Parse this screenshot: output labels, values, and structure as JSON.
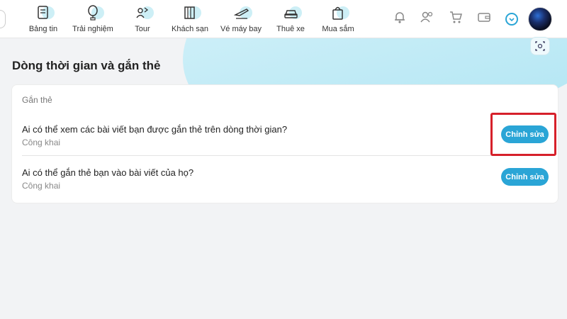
{
  "nav": {
    "items": [
      {
        "label": "Bảng tin",
        "icon": "book-icon"
      },
      {
        "label": "Trải nghiệm",
        "icon": "balloon-icon"
      },
      {
        "label": "Tour",
        "icon": "tour-icon"
      },
      {
        "label": "Khách sạn",
        "icon": "hotel-icon"
      },
      {
        "label": "Vé máy bay",
        "icon": "plane-icon"
      },
      {
        "label": "Thuê xe",
        "icon": "car-icon"
      },
      {
        "label": "Mua sắm",
        "icon": "shopping-bag-icon"
      }
    ]
  },
  "page": {
    "title": "Dòng thời gian và gắn thẻ"
  },
  "card": {
    "section_label": "Gắn thẻ",
    "rows": [
      {
        "question": "Ai có thể xem các bài viết bạn được gắn thẻ trên dòng thời gian?",
        "value": "Công khai",
        "button": "Chỉnh sửa"
      },
      {
        "question": "Ai có thể gắn thẻ bạn vào bài viết của họ?",
        "value": "Công khai",
        "button": "Chỉnh sửa"
      }
    ]
  },
  "colors": {
    "accent": "#2aa5d6",
    "highlight": "#d6202a"
  }
}
